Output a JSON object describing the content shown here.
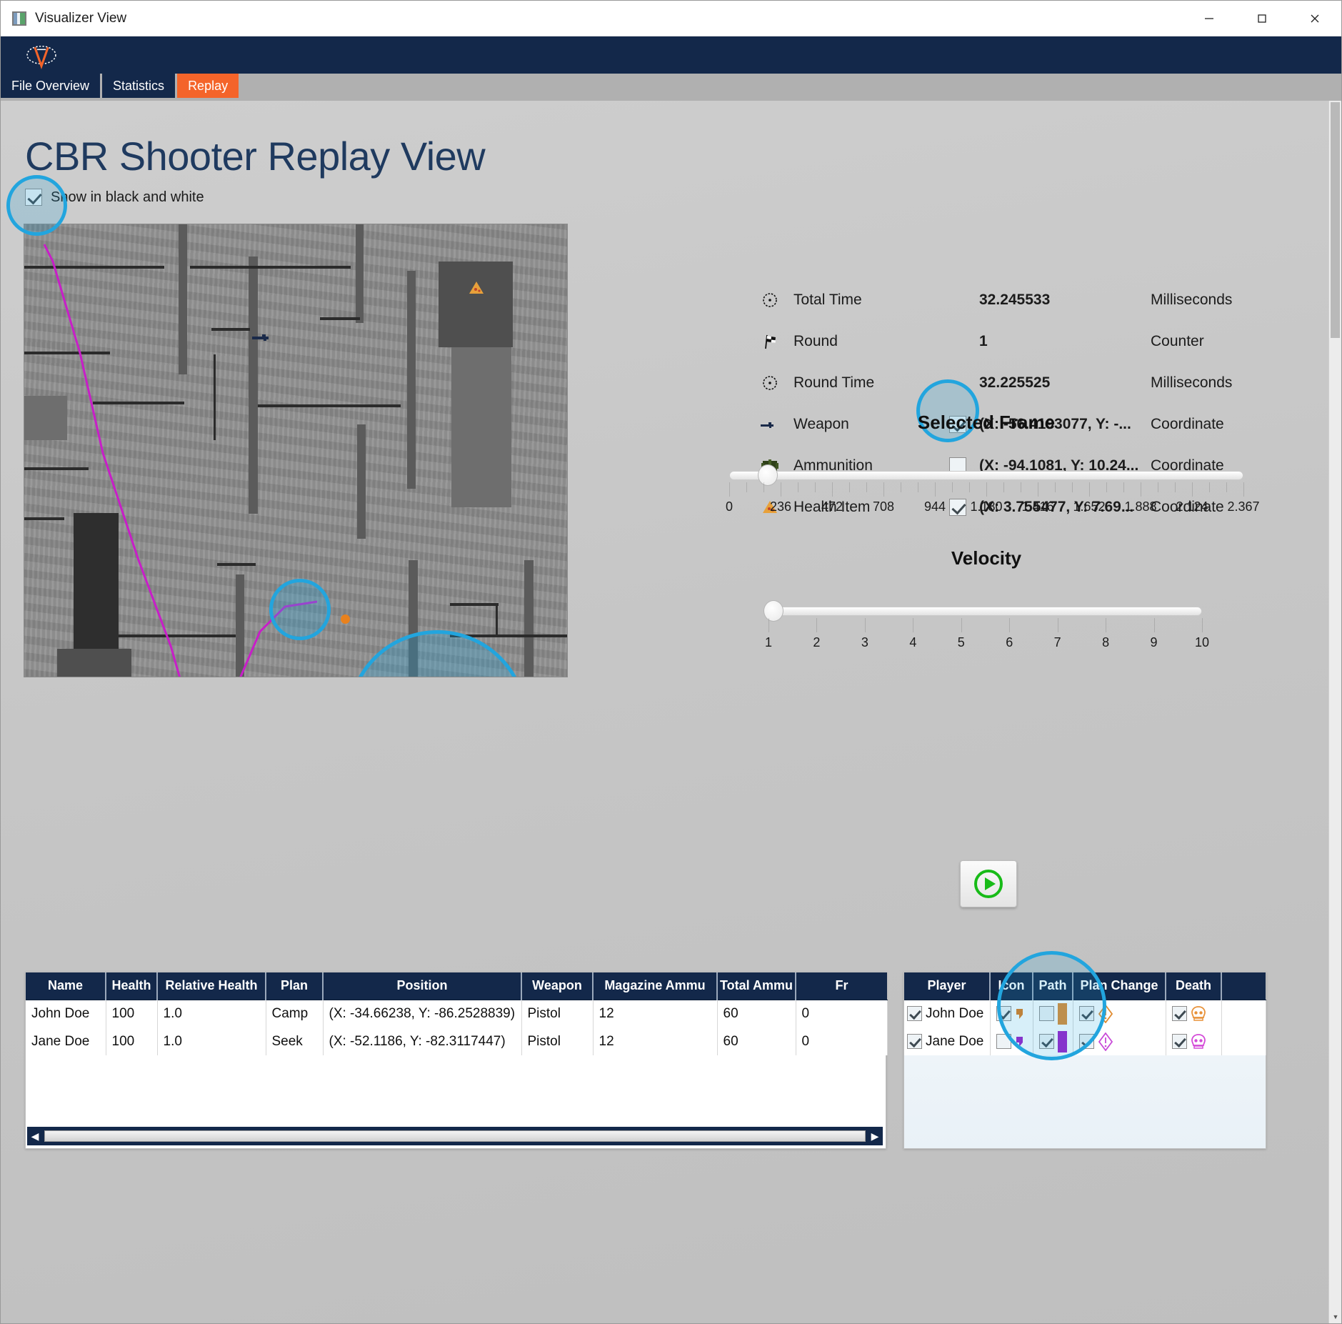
{
  "window": {
    "title": "Visualizer View",
    "app_icon": "chart-icon",
    "minimize": "—",
    "maximize": "☐",
    "close": "✕"
  },
  "tabs": [
    {
      "label": "File Overview",
      "active": false
    },
    {
      "label": "Statistics",
      "active": false
    },
    {
      "label": "Replay",
      "active": true
    }
  ],
  "page": {
    "title": "CBR Shooter Replay View",
    "bw_checkbox_label": "Show in black and white",
    "bw_checkbox_checked": true
  },
  "stats": [
    {
      "icon": "clock-icon",
      "label": "Total Time",
      "has_checkbox": false,
      "checked": false,
      "value": "32.245533",
      "unit": "Milliseconds"
    },
    {
      "icon": "flag-icon",
      "label": "Round",
      "has_checkbox": false,
      "checked": false,
      "value": "1",
      "unit": "Counter"
    },
    {
      "icon": "clock-icon",
      "label": "Round Time",
      "has_checkbox": false,
      "checked": false,
      "value": "32.225525",
      "unit": "Milliseconds"
    },
    {
      "icon": "weapon-icon",
      "label": "Weapon",
      "has_checkbox": true,
      "checked": true,
      "value": "(X: -56.4193077, Y: -...",
      "unit": "Coordinate"
    },
    {
      "icon": "ammunition-icon",
      "label": "Ammunition",
      "has_checkbox": true,
      "checked": false,
      "value": "(X: -94.1081, Y: 10.24...",
      "unit": "Coordinate"
    },
    {
      "icon": "health-item-icon",
      "label": "Health Item",
      "has_checkbox": true,
      "checked": true,
      "value": "(X: 3.755477, Y: 7.69...",
      "unit": "Coordinate"
    }
  ],
  "selected_frame_slider": {
    "title": "Selected Frame",
    "tick_labels": [
      "0",
      "236",
      "472",
      "708",
      "944",
      "1.180",
      "1.416",
      "1.652",
      "1.888",
      "2.124",
      "2.367"
    ],
    "min": 0,
    "max": 2367,
    "value": 236,
    "thumb_percent": 8.5
  },
  "velocity_slider": {
    "title": "Velocity",
    "tick_labels": [
      "1",
      "2",
      "3",
      "4",
      "5",
      "6",
      "7",
      "8",
      "9",
      "10"
    ],
    "min": 1,
    "max": 10,
    "value": 1,
    "thumb_percent": 0
  },
  "play_button": {
    "name": "play-button",
    "glyph": "▶"
  },
  "main_table": {
    "columns": [
      "Name",
      "Health",
      "Relative Health",
      "Plan",
      "Position",
      "Weapon",
      "Magazine Ammu",
      "Total Ammu",
      "Fr"
    ],
    "rows": [
      {
        "name": "John Doe",
        "health": "100",
        "relative_health": "1.0",
        "plan": "Camp",
        "position": "(X: -34.66238, Y: -86.2528839)",
        "weapon": "Pistol",
        "magazine_ammu": "12",
        "total_ammu": "60",
        "frags": "0"
      },
      {
        "name": "Jane Doe",
        "health": "100",
        "relative_health": "1.0",
        "plan": "Seek",
        "position": "(X: -52.1186, Y: -82.3117447)",
        "weapon": "Pistol",
        "magazine_ammu": "12",
        "total_ammu": "60",
        "frags": "0"
      }
    ]
  },
  "legend_table": {
    "columns": [
      "Player",
      "Icon",
      "Path",
      "Plan Change",
      "Death",
      ""
    ],
    "rows": [
      {
        "player": "John Doe",
        "player_checked": true,
        "icon_checked": true,
        "icon_color": "#e07b18",
        "path_checked": false,
        "path_color": "#e08a2e",
        "plan_change_checked": true,
        "plan_change_color": "#e08a2e",
        "death_checked": true,
        "death_color": "#e8923a"
      },
      {
        "player": "Jane Doe",
        "player_checked": true,
        "icon_checked": false,
        "icon_color": "#9b1bc9",
        "path_checked": true,
        "path_color": "#9b1bc9",
        "plan_change_checked": true,
        "plan_change_color": "#c84ad8",
        "death_checked": true,
        "death_color": "#d44ad8"
      }
    ]
  },
  "colors": {
    "brand_navy": "#13284a",
    "accent_orange": "#f4642a",
    "highlight_cyan": "#22a5de",
    "path_magenta": "#c81ec8",
    "play_green": "#18bb18",
    "title_blue": "#1f3a5f"
  },
  "scrollbars": {
    "h_left_arrow": "◀",
    "h_right_arrow": "▶",
    "v_up_arrow": "▲",
    "v_down_arrow": "▼"
  }
}
